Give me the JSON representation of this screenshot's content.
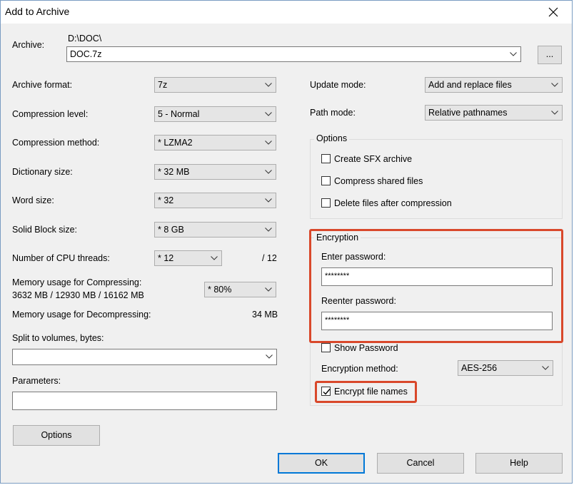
{
  "window": {
    "title": "Add to Archive"
  },
  "archive": {
    "label": "Archive:",
    "path": "D:\\DOC\\",
    "name": "DOC.7z",
    "browse_label": "..."
  },
  "left": {
    "format_label": "Archive format:",
    "format_value": "7z",
    "level_label": "Compression level:",
    "level_value": "5 - Normal",
    "method_label": "Compression method:",
    "method_value": "* LZMA2",
    "dict_label": "Dictionary size:",
    "dict_value": "* 32 MB",
    "word_label": "Word size:",
    "word_value": "* 32",
    "solid_label": "Solid Block size:",
    "solid_value": "* 8 GB",
    "threads_label": "Number of CPU threads:",
    "threads_value": "* 12",
    "threads_max": "/ 12",
    "mem_comp_label": "Memory usage for Compressing:",
    "mem_comp_detail": "3632 MB / 12930 MB / 16162 MB",
    "mem_comp_value": "* 80%",
    "mem_decomp_label": "Memory usage for Decompressing:",
    "mem_decomp_value": "34 MB",
    "split_label": "Split to volumes, bytes:",
    "split_value": "",
    "params_label": "Parameters:",
    "params_value": "",
    "options_button": "Options"
  },
  "right": {
    "update_label": "Update mode:",
    "update_value": "Add and replace files",
    "path_label": "Path mode:",
    "path_value": "Relative pathnames",
    "options_title": "Options",
    "sfx_label": "Create SFX archive",
    "shared_label": "Compress shared files",
    "delete_label": "Delete files after compression",
    "encryption_title": "Encryption",
    "enter_pw_label": "Enter password:",
    "enter_pw_value": "********",
    "reenter_pw_label": "Reenter password:",
    "reenter_pw_value": "********",
    "show_pw_label": "Show Password",
    "enc_method_label": "Encryption method:",
    "enc_method_value": "AES-256",
    "encrypt_names_label": "Encrypt file names",
    "encrypt_names_checked": true
  },
  "footer": {
    "ok": "OK",
    "cancel": "Cancel",
    "help": "Help"
  },
  "colors": {
    "highlight": "#d9482b",
    "accent": "#0078d7"
  }
}
